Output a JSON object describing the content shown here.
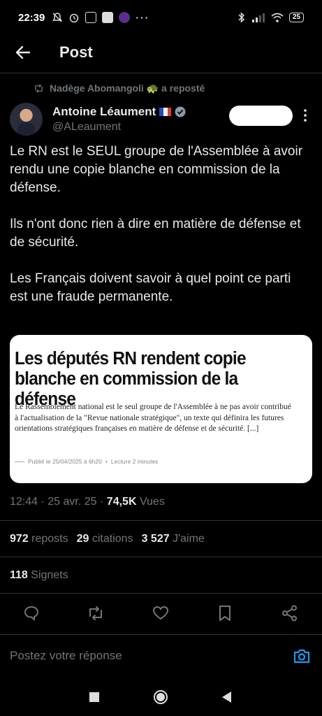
{
  "status_bar": {
    "time": "22:39",
    "dots": "···",
    "battery": "25",
    "icons": [
      "mute-icon",
      "alarm-icon",
      "news-icon",
      "app-icon",
      "app2-icon",
      "bluetooth-icon",
      "signal-icon",
      "wifi-icon",
      "battery-icon"
    ]
  },
  "header": {
    "title": "Post"
  },
  "repost": {
    "text": "Nadège Abomangoli 🐢 a reposté"
  },
  "author": {
    "name": "Antoine Léaument",
    "handle": "@ALeaument",
    "verified_color": "#8b98a5"
  },
  "tweet": {
    "paragraphs": [
      "Le RN est le SEUL groupe de l'Assemblée à avoir rendu une copie blanche en commission de la défense.",
      "Ils n'ont donc rien à dire en matière de défense et de sécurité.",
      "Les Français doivent savoir à quel point ce parti est une fraude permanente."
    ]
  },
  "card": {
    "headline": "Les députés RN rendent copie blanche en commission de la défense",
    "body": "Le Rassemblement national est le seul groupe de l'Assemblée à ne pas avoir contribué à l'actualisation de la \"Revue nationale stratégique\", un texte qui définira les futures orientations stratégiques françaises en matière de défense et de sécurité. [...]",
    "meta_published": "Publié le 25/04/2025 à 6h20",
    "meta_sep": "•",
    "meta_read": "Lecture 2 minutes"
  },
  "timestamp": {
    "time": "12:44",
    "sep1": "·",
    "date": "25 avr. 25",
    "sep2": "·",
    "views": "74,5K",
    "views_label": "Vues"
  },
  "stats": {
    "reposts_count": "972",
    "reposts_label": "reposts",
    "quotes_count": "29",
    "quotes_label": "citations",
    "likes_count": "3 527",
    "likes_label": "J'aime",
    "bookmarks_count": "118",
    "bookmarks_label": "Signets"
  },
  "reply": {
    "placeholder": "Postez votre réponse"
  },
  "colors": {
    "background": "#000000",
    "text": "#e7e9ea",
    "muted": "#71767b",
    "accent": "#1d9bf0",
    "divider": "#2f3336"
  }
}
